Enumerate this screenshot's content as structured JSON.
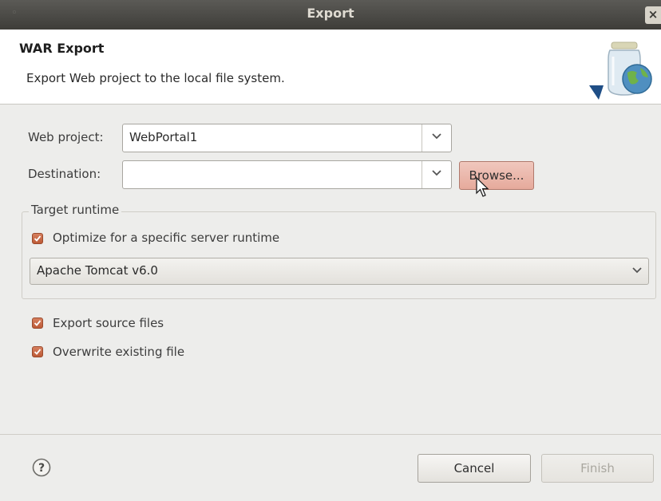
{
  "window": {
    "title": "Export",
    "close_glyph": "×"
  },
  "banner": {
    "heading": "WAR Export",
    "description": "Export Web project to the local file system.",
    "icon": "jar-globe-icon"
  },
  "web_project": {
    "label": "Web project:",
    "value": "WebPortal1"
  },
  "destination": {
    "label": "Destination:",
    "value": "",
    "browse_label": "Browse..."
  },
  "target_runtime": {
    "title": "Target runtime",
    "optimize_label": "Optimize for a specific server runtime",
    "optimize_checked": true,
    "selected_runtime": "Apache Tomcat v6.0"
  },
  "options": {
    "export_source_label": "Export source files",
    "export_source_checked": true,
    "overwrite_label": "Overwrite existing file",
    "overwrite_checked": true
  },
  "footer": {
    "help_icon": "question-mark-icon",
    "cancel_label": "Cancel",
    "finish_label": "Finish"
  },
  "colors": {
    "accent_check": "#c8653f",
    "hover_button": "#e9b3a6",
    "titlebar": "#4a4945"
  }
}
